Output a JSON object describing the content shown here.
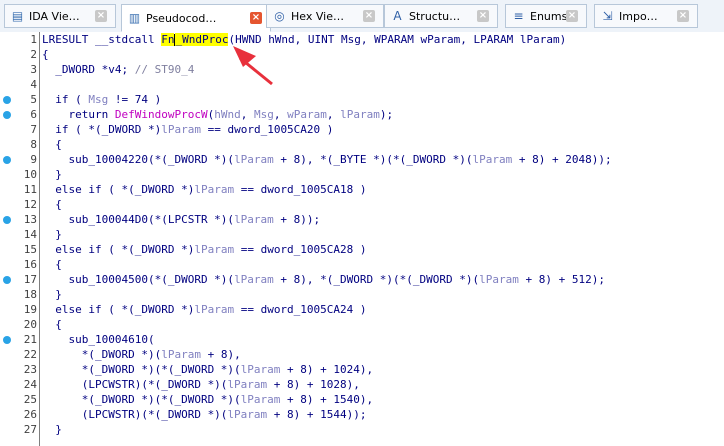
{
  "tabs": [
    {
      "label": "IDA Vie…",
      "icon": "ida-view-icon",
      "active": false
    },
    {
      "label": "Pseudocod…",
      "icon": "pseudocode-icon",
      "active": true
    },
    {
      "label": "Hex Vie…",
      "icon": "hex-view-icon",
      "active": false
    },
    {
      "label": "Structu…",
      "icon": "structures-icon",
      "active": false
    },
    {
      "label": "Enums",
      "icon": "enums-icon",
      "active": false
    },
    {
      "label": "Impo…",
      "icon": "imports-icon",
      "active": false
    }
  ],
  "code_lines": [
    {
      "num": "1",
      "dot": false,
      "segments": [
        [
          "t",
          "LRESULT __stdcall "
        ],
        [
          "hl",
          "Fn"
        ],
        [
          "cur",
          ""
        ],
        [
          "hl",
          "_WndProc"
        ],
        [
          "t",
          "(HWND hWnd, UINT Msg, WPARAM wParam, LPARAM lParam)"
        ]
      ]
    },
    {
      "num": "2",
      "dot": false,
      "segments": [
        [
          "t",
          "{"
        ]
      ]
    },
    {
      "num": "3",
      "dot": false,
      "segments": [
        [
          "t",
          "  _DWORD *v4; "
        ],
        [
          "g",
          "// ST90_4"
        ]
      ]
    },
    {
      "num": "4",
      "dot": false,
      "segments": [
        [
          "t",
          ""
        ]
      ]
    },
    {
      "num": "5",
      "dot": true,
      "segments": [
        [
          "t",
          "  if ( "
        ],
        [
          "v",
          "Msg"
        ],
        [
          "t",
          " != 74 )"
        ]
      ]
    },
    {
      "num": "6",
      "dot": true,
      "segments": [
        [
          "t",
          "    return "
        ],
        [
          "f",
          "DefWindowProcW"
        ],
        [
          "t",
          "("
        ],
        [
          "v",
          "hWnd"
        ],
        [
          "t",
          ", "
        ],
        [
          "v",
          "Msg"
        ],
        [
          "t",
          ", "
        ],
        [
          "v",
          "wParam"
        ],
        [
          "t",
          ", "
        ],
        [
          "v",
          "lParam"
        ],
        [
          "t",
          ");"
        ]
      ]
    },
    {
      "num": "7",
      "dot": false,
      "segments": [
        [
          "t",
          "  if ( *(_DWORD *)"
        ],
        [
          "v",
          "lParam"
        ],
        [
          "t",
          " == dword_1005CA20 )"
        ]
      ]
    },
    {
      "num": "8",
      "dot": false,
      "segments": [
        [
          "t",
          "  {"
        ]
      ]
    },
    {
      "num": "9",
      "dot": true,
      "segments": [
        [
          "t",
          "    sub_10004220(*(_DWORD *)("
        ],
        [
          "v",
          "lParam"
        ],
        [
          "t",
          " + 8), *(_BYTE *)(*(_DWORD *)("
        ],
        [
          "v",
          "lParam"
        ],
        [
          "t",
          " + 8) + 2048));"
        ]
      ]
    },
    {
      "num": "10",
      "dot": false,
      "segments": [
        [
          "t",
          "  }"
        ]
      ]
    },
    {
      "num": "11",
      "dot": false,
      "segments": [
        [
          "t",
          "  else if ( *(_DWORD *)"
        ],
        [
          "v",
          "lParam"
        ],
        [
          "t",
          " == dword_1005CA18 )"
        ]
      ]
    },
    {
      "num": "12",
      "dot": false,
      "segments": [
        [
          "t",
          "  {"
        ]
      ]
    },
    {
      "num": "13",
      "dot": true,
      "segments": [
        [
          "t",
          "    sub_100044D0(*(LPCSTR *)("
        ],
        [
          "v",
          "lParam"
        ],
        [
          "t",
          " + 8));"
        ]
      ]
    },
    {
      "num": "14",
      "dot": false,
      "segments": [
        [
          "t",
          "  }"
        ]
      ]
    },
    {
      "num": "15",
      "dot": false,
      "segments": [
        [
          "t",
          "  else if ( *(_DWORD *)"
        ],
        [
          "v",
          "lParam"
        ],
        [
          "t",
          " == dword_1005CA28 )"
        ]
      ]
    },
    {
      "num": "16",
      "dot": false,
      "segments": [
        [
          "t",
          "  {"
        ]
      ]
    },
    {
      "num": "17",
      "dot": true,
      "segments": [
        [
          "t",
          "    sub_10004500(*(_DWORD *)("
        ],
        [
          "v",
          "lParam"
        ],
        [
          "t",
          " + 8), *(_DWORD *)(*(_DWORD *)("
        ],
        [
          "v",
          "lParam"
        ],
        [
          "t",
          " + 8) + 512);"
        ]
      ]
    },
    {
      "num": "18",
      "dot": false,
      "segments": [
        [
          "t",
          "  }"
        ]
      ]
    },
    {
      "num": "19",
      "dot": false,
      "segments": [
        [
          "t",
          "  else if ( *(_DWORD *)"
        ],
        [
          "v",
          "lParam"
        ],
        [
          "t",
          " == dword_1005CA24 )"
        ]
      ]
    },
    {
      "num": "20",
      "dot": false,
      "segments": [
        [
          "t",
          "  {"
        ]
      ]
    },
    {
      "num": "21",
      "dot": true,
      "segments": [
        [
          "t",
          "    sub_10004610("
        ]
      ]
    },
    {
      "num": "22",
      "dot": false,
      "segments": [
        [
          "t",
          "      *(_DWORD *)("
        ],
        [
          "v",
          "lParam"
        ],
        [
          "t",
          " + 8),"
        ]
      ]
    },
    {
      "num": "23",
      "dot": false,
      "segments": [
        [
          "t",
          "      *(_DWORD *)(*(_DWORD *)("
        ],
        [
          "v",
          "lParam"
        ],
        [
          "t",
          " + 8) + 1024),"
        ]
      ]
    },
    {
      "num": "24",
      "dot": false,
      "segments": [
        [
          "t",
          "      (LPCWSTR)(*(_DWORD *)("
        ],
        [
          "v",
          "lParam"
        ],
        [
          "t",
          " + 8) + 1028),"
        ]
      ]
    },
    {
      "num": "25",
      "dot": false,
      "segments": [
        [
          "t",
          "      *(_DWORD *)(*(_DWORD *)("
        ],
        [
          "v",
          "lParam"
        ],
        [
          "t",
          " + 8) + 1540),"
        ]
      ]
    },
    {
      "num": "26",
      "dot": false,
      "segments": [
        [
          "t",
          "      (LPCWSTR)(*(_DWORD *)("
        ],
        [
          "v",
          "lParam"
        ],
        [
          "t",
          " + 8) + 1544));"
        ]
      ]
    },
    {
      "num": "27",
      "dot": false,
      "segments": [
        [
          "t",
          "  }"
        ]
      ]
    }
  ],
  "colors": {
    "highlight": "#ffff00",
    "arrow": "#e8303c",
    "breakpoint_dot": "#29a3e6",
    "variable": "#8080c0",
    "function": "#c000c0",
    "comment": "#7f7f9f"
  }
}
